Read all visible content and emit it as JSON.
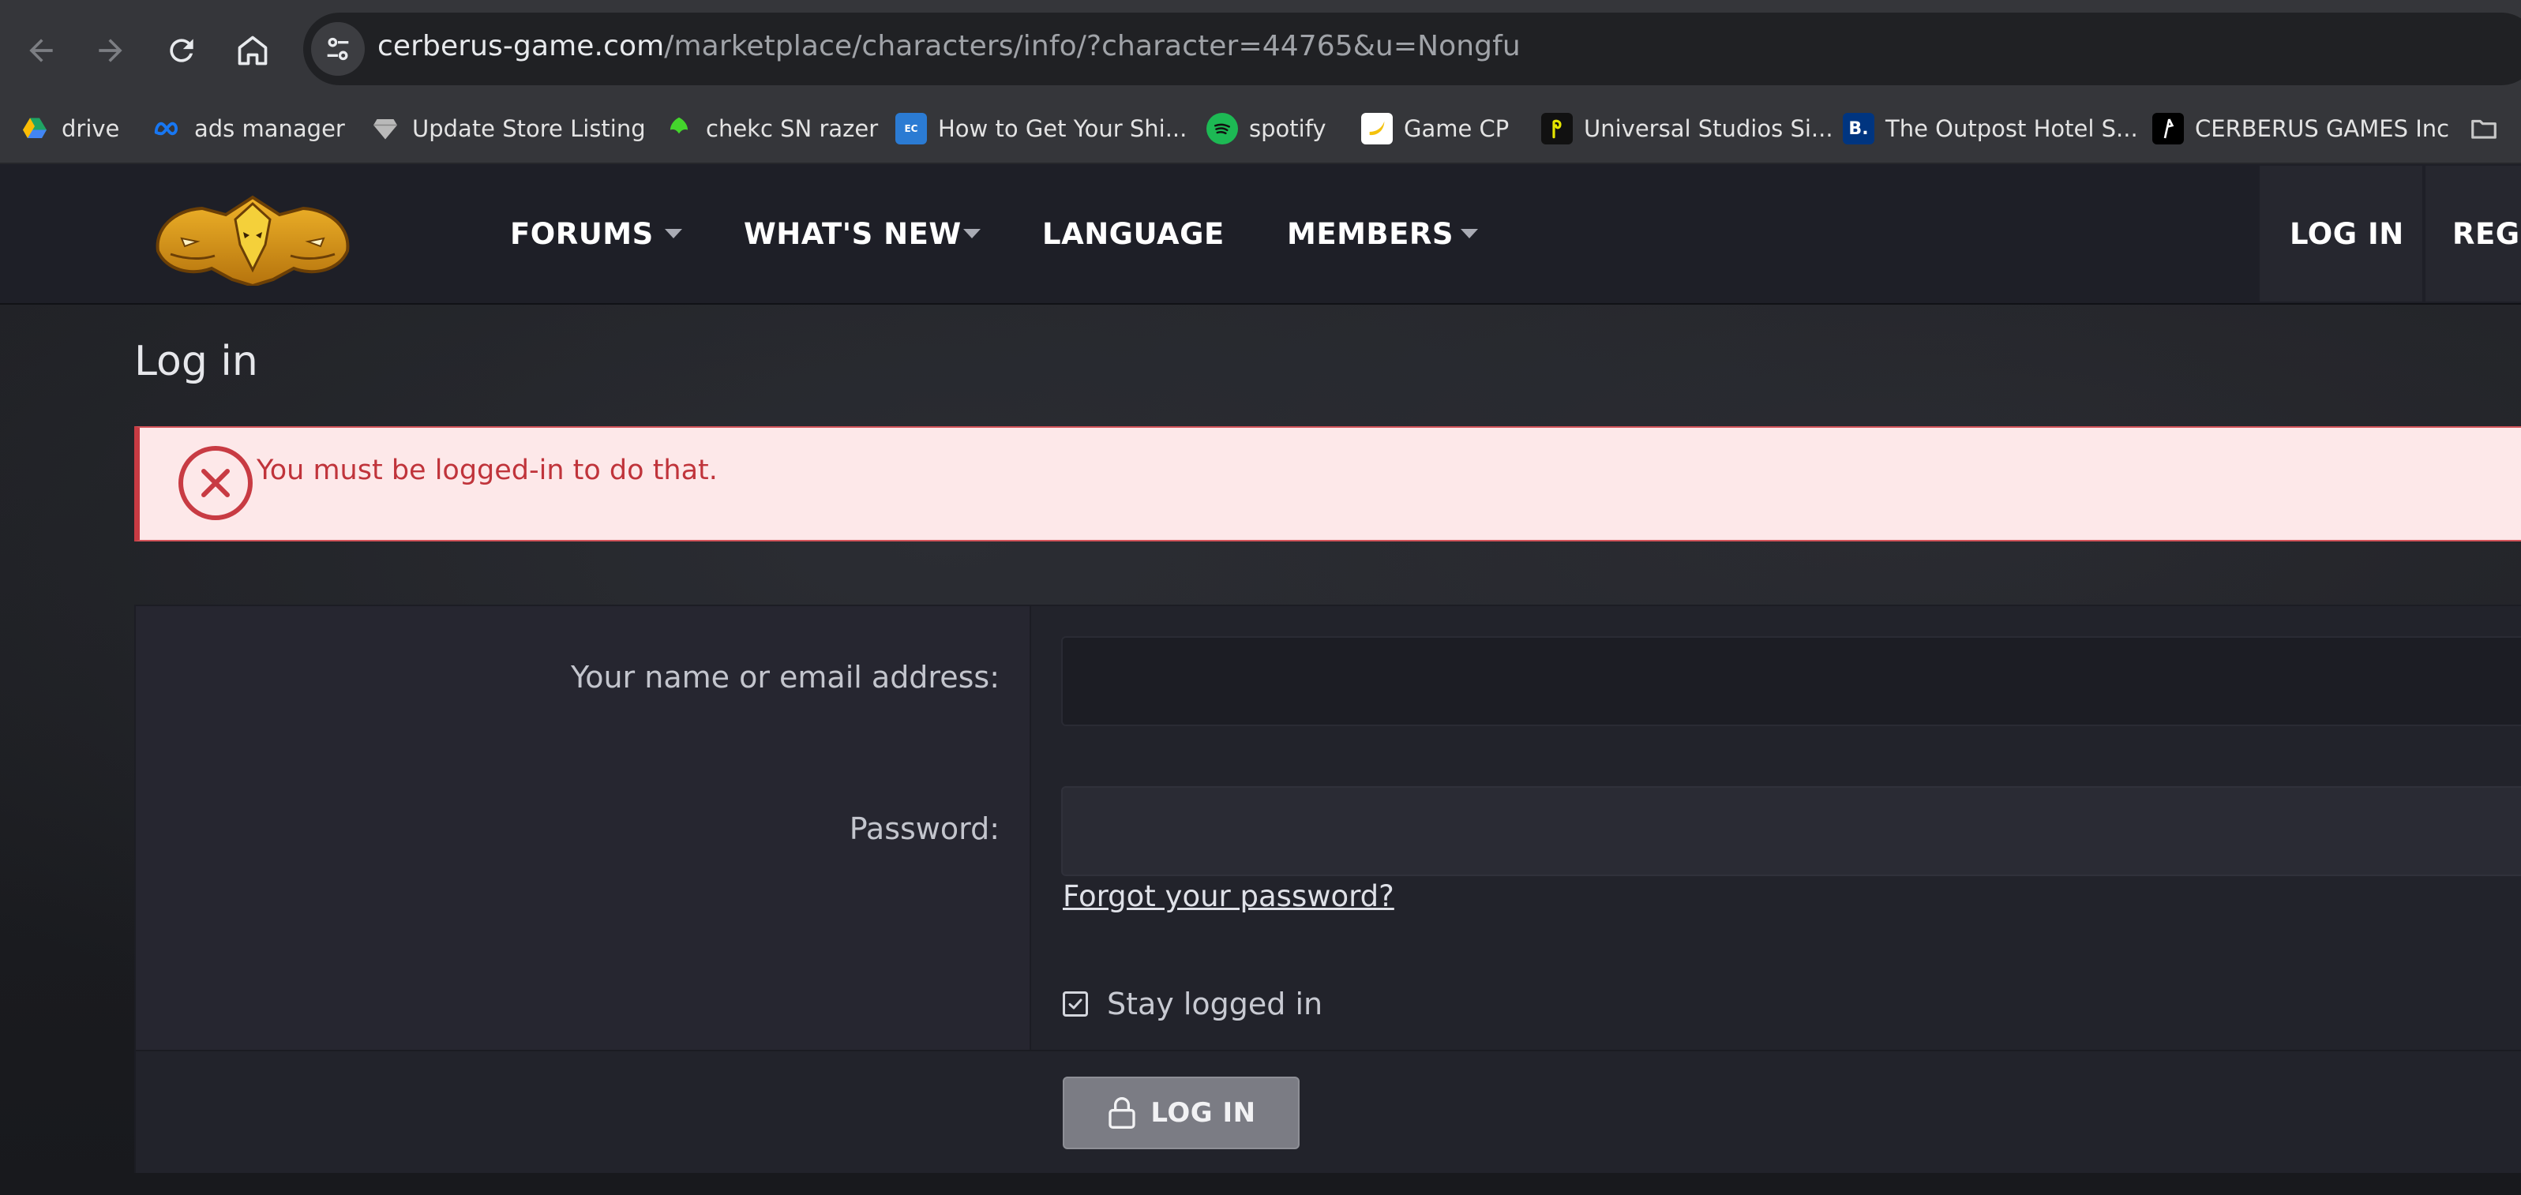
{
  "browser": {
    "url_host": "cerberus-game.com",
    "url_path": "/marketplace/characters/info/?character=44765&u=Nongfu",
    "back_icon": "arrow-left-icon",
    "forward_icon": "arrow-right-icon",
    "reload_icon": "reload-icon",
    "home_icon": "home-icon",
    "site_info_icon": "tune-icon"
  },
  "bookmarks": [
    {
      "label": "drive",
      "icon": "google-drive-icon"
    },
    {
      "label": "ads manager",
      "icon": "meta-icon"
    },
    {
      "label": "Update Store Listing",
      "icon": "diamond-icon"
    },
    {
      "label": "chekc SN razer",
      "icon": "razer-icon"
    },
    {
      "label": "How to Get Your Shi...",
      "icon": "ecom-icon"
    },
    {
      "label": "spotify",
      "icon": "spotify-icon"
    },
    {
      "label": "Game CP",
      "icon": "banana-icon"
    },
    {
      "label": "Universal Studios Si...",
      "icon": "universal-icon"
    },
    {
      "label": "The Outpost Hotel S...",
      "icon": "booking-icon"
    },
    {
      "label": "CERBERUS GAMES Inc",
      "icon": "cerberus-icon"
    },
    {
      "label": "",
      "icon": "folder-icon"
    }
  ],
  "header": {
    "logo_icon": "cerberus-logo-icon",
    "nav": [
      {
        "label": "FORUMS",
        "has_menu": true
      },
      {
        "label": "WHAT'S NEW",
        "has_menu": true
      },
      {
        "label": "LANGUAGE",
        "has_menu": false
      },
      {
        "label": "MEMBERS",
        "has_menu": true
      }
    ],
    "login_label": "LOG IN",
    "register_label": "REGI"
  },
  "page": {
    "title": "Log in",
    "error_message": "You must be logged-in to do that.",
    "error_icon": "error-x-circle-icon"
  },
  "form": {
    "username_label": "Your name or email address:",
    "username_value": "",
    "password_label": "Password:",
    "password_value": "",
    "forgot_label": "Forgot your password?",
    "stay_logged_in_label": "Stay logged in",
    "stay_logged_in_checked": true,
    "submit_label": "LOG IN",
    "submit_icon": "lock-icon"
  },
  "colors": {
    "chrome_bg": "#35363a",
    "header_bg": "#1e1f27",
    "error_bg": "#fde8e9",
    "error_text": "#c0343b",
    "logo_gold": "#e3a21b",
    "button_bg": "#7b7c84"
  }
}
